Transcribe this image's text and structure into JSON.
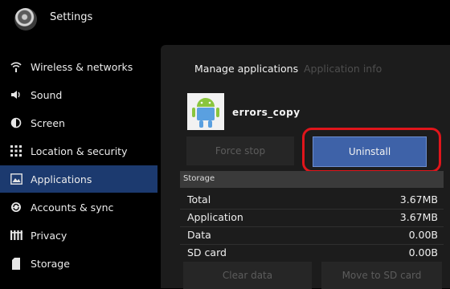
{
  "header": {
    "title": "Settings",
    "icon": "settings-gear-icon"
  },
  "sidebar": {
    "items": [
      {
        "label": "Wireless & networks",
        "icon": "wifi-icon"
      },
      {
        "label": "Sound",
        "icon": "speaker-icon"
      },
      {
        "label": "Screen",
        "icon": "brightness-icon"
      },
      {
        "label": "Location & security",
        "icon": "location-grid-icon"
      },
      {
        "label": "Applications",
        "icon": "applications-icon",
        "active": true
      },
      {
        "label": "Accounts & sync",
        "icon": "sync-icon"
      },
      {
        "label": "Privacy",
        "icon": "privacy-icon"
      },
      {
        "label": "Storage",
        "icon": "storage-icon"
      }
    ]
  },
  "panel": {
    "breadcrumb": {
      "manage": "Manage applications",
      "info": "Application info"
    },
    "app": {
      "name": "errors_copy",
      "icon": "android-robot-icon"
    },
    "buttons": {
      "force_stop": "Force stop",
      "uninstall": "Uninstall",
      "clear_data": "Clear data",
      "move_to_sd": "Move to SD card"
    },
    "storage": {
      "header": "Storage",
      "rows": [
        {
          "label": "Total",
          "value": "3.67MB"
        },
        {
          "label": "Application",
          "value": "3.67MB"
        },
        {
          "label": "Data",
          "value": "0.00B"
        },
        {
          "label": "SD card",
          "value": "0.00B"
        }
      ]
    }
  },
  "colors": {
    "accent": "#3e62a8",
    "active_item": "#1c3a6f",
    "highlight": "#e0151b"
  }
}
